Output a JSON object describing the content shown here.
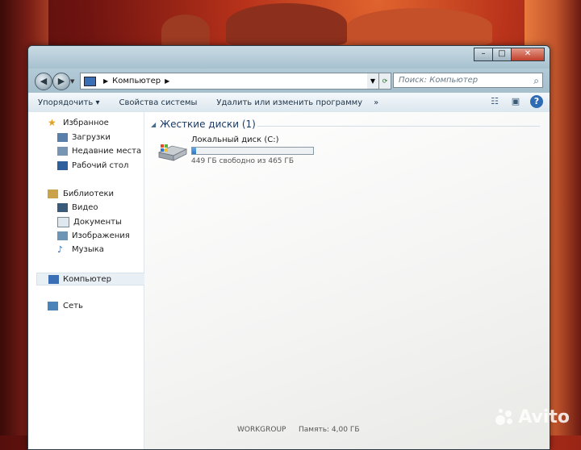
{
  "address": {
    "crumb": "Компьютер"
  },
  "search": {
    "placeholder": "Поиск: Компьютер"
  },
  "toolbar": {
    "organize": "Упорядочить ▾",
    "system_props": "Свойства системы",
    "uninstall": "Удалить или изменить программу",
    "more": "»"
  },
  "nav": {
    "favorites": "Избранное",
    "downloads": "Загрузки",
    "recent": "Недавние места",
    "desktop": "Рабочий стол",
    "libraries": "Библиотеки",
    "video": "Видео",
    "documents": "Документы",
    "images": "Изображения",
    "music": "Музыка",
    "computer": "Компьютер",
    "network": "Сеть"
  },
  "content": {
    "group_title": "Жесткие диски (1)",
    "drive": {
      "name": "Локальный диск (C:)",
      "info": "449 ГБ свободно из 465 ГБ",
      "used_fraction": 0.034
    }
  },
  "status": {
    "workgroup": "WORKGROUP",
    "memory": "Память: 4,00 ГБ"
  },
  "watermark": {
    "text": "Avito"
  },
  "colors": {
    "accent": "#2c76c4",
    "title_blue": "#1c3a63"
  }
}
